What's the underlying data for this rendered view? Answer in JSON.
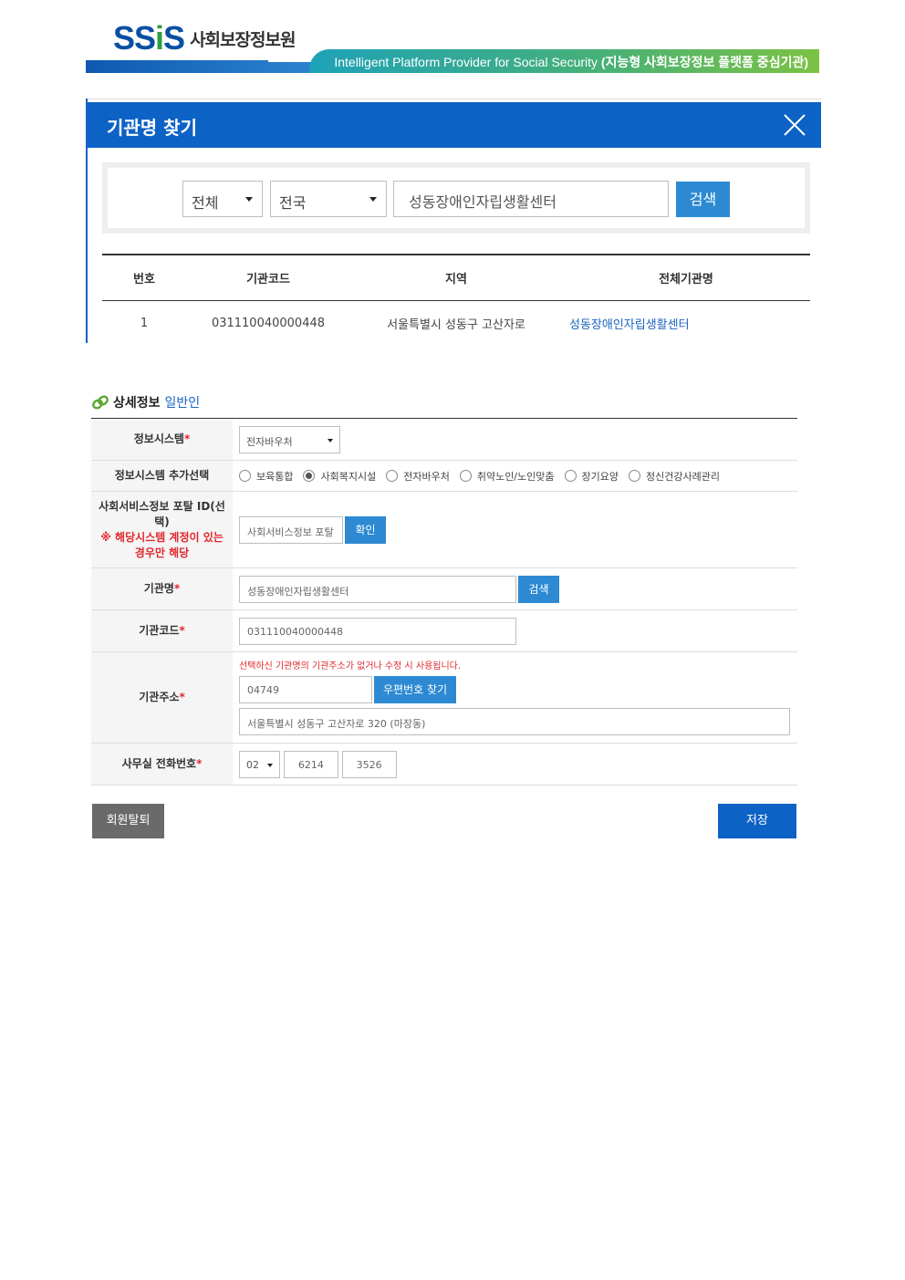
{
  "header": {
    "logo_mark": "SSiS",
    "logo_text": "사회보장정보원",
    "slogan_en": "Intelligent Platform Provider for Social Security",
    "slogan_ko": "(지능형 사회보장정보 플랫폼 중심기관)"
  },
  "popup": {
    "title": "기관명 찾기",
    "search": {
      "type_value": "전체",
      "region_value": "전국",
      "keyword_value": "성동장애인자립생활센터",
      "search_label": "검색"
    },
    "table": {
      "headers": [
        "번호",
        "기관코드",
        "지역",
        "전체기관명"
      ],
      "rows": [
        {
          "no": "1",
          "code": "031110040000448",
          "region": "서울특별시 성동구 고산자로",
          "name": "성동장애인자립생활센터"
        }
      ]
    }
  },
  "detail": {
    "heading": "상세정보",
    "heading_sub": "일반인",
    "required_mark": "*",
    "info_system": {
      "label": "정보시스템",
      "value": "전자바우처"
    },
    "extra_system": {
      "label": "정보시스템 추가선택",
      "options": [
        "보육통합",
        "사회복지시설",
        "전자바우처",
        "취약노인/노인맞춤",
        "장기요양",
        "정신건강사례관리"
      ],
      "selected": "사회복지시설"
    },
    "portal_id": {
      "label": "사회서비스정보 포탈 ID(선택)",
      "note": "※ 해당시스템 계정이 있는 경우만 해당",
      "placeholder": "사회서비스정보 포탈",
      "confirm_label": "확인"
    },
    "org_name": {
      "label": "기관명",
      "value": "성동장애인자립생활센터",
      "search_label": "검색"
    },
    "org_code": {
      "label": "기관코드",
      "value": "031110040000448"
    },
    "org_address": {
      "label": "기관주소",
      "note": "선택하신 기관명의 기관주소가 없거나 수정 시 사용됩니다.",
      "zip": "04749",
      "zip_btn": "우편번호 찾기",
      "address": "서울특별시 성동구 고산자로 320 (마장동)"
    },
    "phone": {
      "label": "사무실 전화번호",
      "area": "02",
      "mid": "6214",
      "last": "3526"
    }
  },
  "buttons": {
    "withdraw": "회원탈퇴",
    "save": "저장"
  }
}
